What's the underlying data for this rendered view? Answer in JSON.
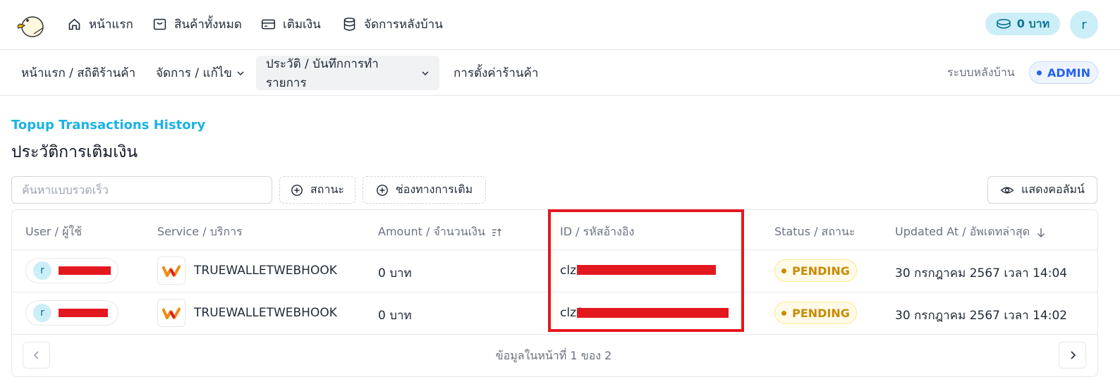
{
  "nav": {
    "items": [
      {
        "label": "หน้าแรก",
        "icon": "home-icon"
      },
      {
        "label": "สินค้าทั้งหมด",
        "icon": "shop-icon"
      },
      {
        "label": "เติมเงิน",
        "icon": "wallet-icon"
      },
      {
        "label": "จัดการหลังบ้าน",
        "icon": "database-icon"
      }
    ],
    "credit": "0 บาท",
    "user_initial": "r"
  },
  "subnav": {
    "items": [
      {
        "label": "หน้าแรก / สถิติร้านค้า"
      },
      {
        "label": "จัดการ / แก้ไข"
      },
      {
        "label": "ประวัติ / บันทึกการทำรายการ"
      },
      {
        "label": "การตั้งค่าร้านค้า"
      }
    ],
    "backend_label": "ระบบหลังบ้าน",
    "role_badge": "ADMIN"
  },
  "page": {
    "title_en": "Topup Transactions History",
    "title_th": "ประวัติการเติมเงิน"
  },
  "filters": {
    "search_placeholder": "ค้นหาแบบรวดเร็ว",
    "status_label": "สถานะ",
    "channel_label": "ช่องทางการเติม",
    "columns_label": "แสดงคอลัมน์"
  },
  "table": {
    "headers": {
      "user": "User / ผู้ใช้",
      "service": "Service / บริการ",
      "amount": "Amount / จำนวนเงิน",
      "id": "ID / รหัสอ้างอิง",
      "status": "Status / สถานะ",
      "updated": "Updated At / อัพเดทล่าสุด"
    },
    "rows": [
      {
        "user_initial": "r",
        "service": "TRUEWALLETWEBHOOK",
        "amount": "0 บาท",
        "id_prefix": "clz8",
        "status": "PENDING",
        "updated": "30 กรกฎาคม 2567 เวลา 14:04"
      },
      {
        "user_initial": "r",
        "service": "TRUEWALLETWEBHOOK",
        "amount": "0 บาท",
        "id_prefix": "clz8",
        "status": "PENDING",
        "updated": "30 กรกฎาคม 2567 เวลา 14:02"
      }
    ]
  },
  "pagination": {
    "info": "ข้อมูลในหน้าที่ 1 ของ 2"
  },
  "colors": {
    "accent": "#1ab2e5",
    "redaction": "#e3181f",
    "pending": "#ca8a04",
    "admin": "#2563eb"
  }
}
